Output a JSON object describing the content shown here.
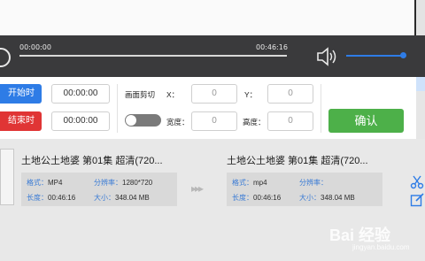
{
  "player": {
    "current_time": "00:00:00",
    "total_time": "00:46:16",
    "progress": 0,
    "volume": 1.0
  },
  "trim": {
    "start_label": "开始时间",
    "end_label": "结束时间",
    "start_value": "00:00:00",
    "end_value": "00:00:00"
  },
  "crop": {
    "title": "画面剪切",
    "x_label": "X：",
    "y_label": "Y：",
    "width_label": "宽度：",
    "height_label": "高度：",
    "x_value": "0",
    "y_value": "0",
    "width_value": "0",
    "height_value": "0"
  },
  "confirm_label": "确认",
  "source": {
    "title": "土地公土地婆 第01集 超清(720...",
    "format_key": "格式：",
    "format_val": "MP4",
    "res_key": "分辨率：",
    "res_val": "1280*720",
    "dur_key": "长度：",
    "dur_val": "00:46:16",
    "size_key": "大小：",
    "size_val": "348.04 MB"
  },
  "target": {
    "title": "土地公土地婆 第01集 超清(720...",
    "format_key": "格式：",
    "format_val": "mp4",
    "res_key": "分辨率：",
    "res_val": "",
    "dur_key": "长度：",
    "dur_val": "00:46:16",
    "size_key": "大小：",
    "size_val": "348.04 MB"
  },
  "watermark": {
    "brand": "Bai 经验",
    "url": "jingyan.baidu.com"
  },
  "colors": {
    "accent_blue": "#2e7ce6",
    "accent_red": "#e03535",
    "accent_green": "#4db049",
    "player_bar": "#3a3a3c"
  }
}
